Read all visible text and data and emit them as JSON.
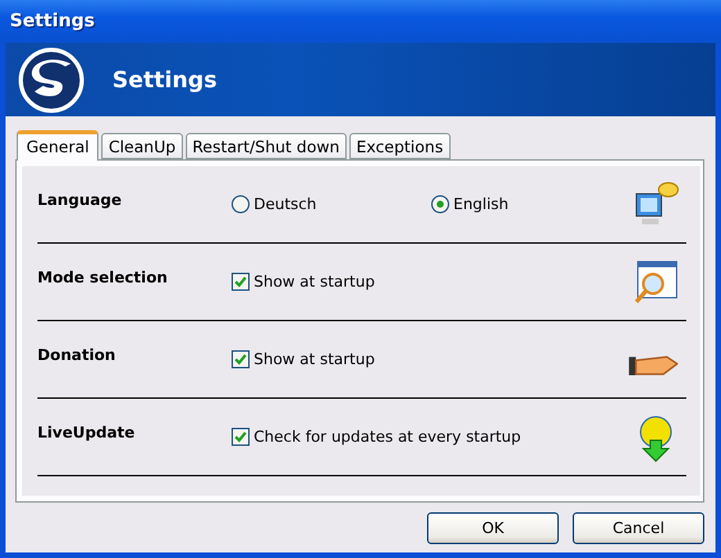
{
  "window": {
    "title": "Settings"
  },
  "header": {
    "title": "Settings"
  },
  "tabs": [
    {
      "label": "General",
      "selected": true
    },
    {
      "label": "CleanUp",
      "selected": false
    },
    {
      "label": "Restart/Shut down",
      "selected": false
    },
    {
      "label": "Exceptions",
      "selected": false
    }
  ],
  "rows": [
    {
      "kind": "radio",
      "label": "Language",
      "options": [
        {
          "label": "Deutsch",
          "selected": false
        },
        {
          "label": "English",
          "selected": true
        }
      ]
    },
    {
      "kind": "checkbox",
      "label": "Mode selection",
      "option": {
        "label": "Show at startup",
        "checked": true
      }
    },
    {
      "kind": "checkbox",
      "label": "Donation",
      "option": {
        "label": "Show at startup",
        "checked": true
      }
    },
    {
      "kind": "checkbox",
      "label": "LiveUpdate",
      "option": {
        "label": "Check for updates at every startup",
        "checked": true
      }
    }
  ],
  "buttons": [
    "OK",
    "Cancel"
  ]
}
